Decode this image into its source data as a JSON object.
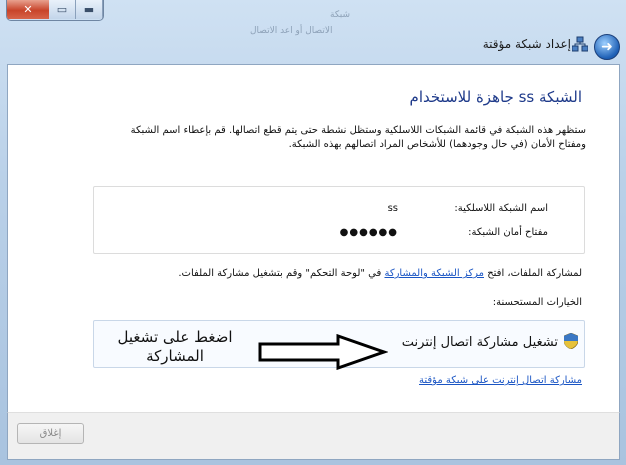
{
  "window": {
    "header_title": "إعداد شبكة مؤقتة",
    "background_hint_1": "شبكة",
    "background_hint_2": "الاتصال أو اعد الاتصال"
  },
  "content": {
    "title": "الشبكة ss جاهزة للاستخدام",
    "description": "ستظهر هذه الشبكة في قائمة الشبكات اللاسلكية وستظل نشطة حتى يتم قطع اتصالها. قم بإعطاء اسم الشبكة ومفتاح الأمان (في حال وجودهما) للأشخاص المراد اتصالهم بهذه الشبكة.",
    "network_name_label": "اسم الشبكة اللاسلكية:",
    "network_name_value": "ss",
    "security_key_label": "مفتاح أمان الشبكة:",
    "security_key_value": "●●●●●●",
    "share_prefix": "لمشاركة الملفات، افتح",
    "share_link": "مركز الشبكة والمشاركة",
    "share_suffix": "في \"لوحة التحكم\" وقم بتشغيل مشاركة الملفات.",
    "recommended_label": "الخيارات المستحسنة:",
    "option_label": "تشغيل مشاركة اتصال إنترنت",
    "annotation": "اضغط على تشغيل المشاركة",
    "adhoc_link": "مشاركة اتصال إنترنت على شبكة مؤقتة"
  },
  "footer": {
    "close_label": "إغلاق"
  }
}
